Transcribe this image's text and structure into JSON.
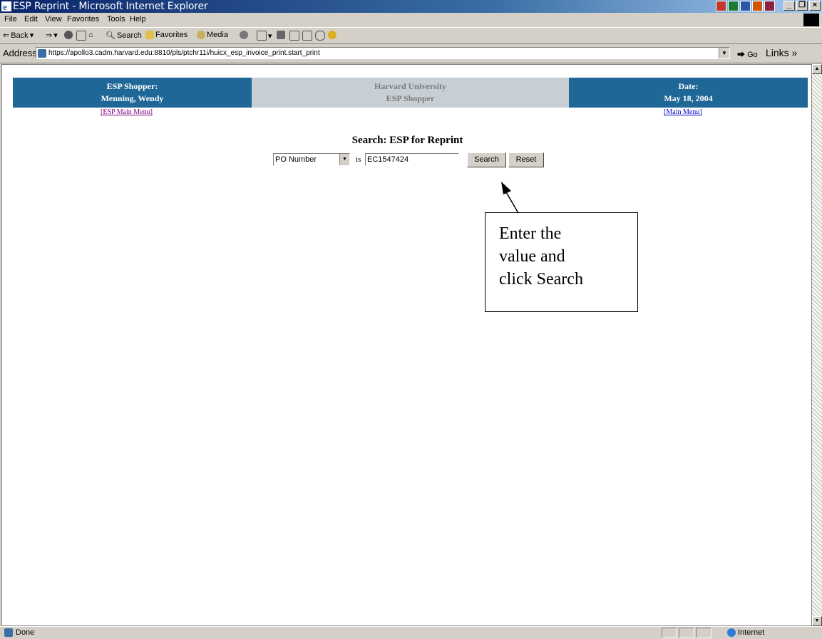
{
  "window": {
    "title": "ESP Reprint - Microsoft Internet Explorer"
  },
  "menu": [
    "File",
    "Edit",
    "View",
    "Favorites",
    "Tools",
    "Help"
  ],
  "toolbar": {
    "back": "Back",
    "search": "Search",
    "favorites": "Favorites",
    "media": "Media"
  },
  "address": {
    "label": "Address",
    "url": "https://apollo3.cadm.harvard.edu:8810/pls/ptchr11i/huicx_esp_invoice_print.start_print",
    "go": "Go",
    "links": "Links"
  },
  "header": {
    "shopper_label": "ESP Shopper:",
    "shopper_name": "Menning, Wendy",
    "org_line1": "Harvard University",
    "org_line2": "ESP Shopper",
    "date_label": "Date:",
    "date_value": "May 18, 2004",
    "left_link": "[ESP Main Menu]",
    "right_link": "[Main Menu]"
  },
  "search": {
    "title": "Search: ESP for Reprint",
    "field": "PO Number",
    "operator": "is",
    "value": "EC1547424",
    "search_button": "Search",
    "reset_button": "Reset"
  },
  "callout": {
    "line1": "Enter the",
    "line2": "value and",
    "line3": "click Search"
  },
  "status": {
    "text": "Done",
    "zone": "Internet"
  },
  "colors": {
    "header_blue": "#1f6796",
    "header_grey": "#c8cfd4"
  }
}
